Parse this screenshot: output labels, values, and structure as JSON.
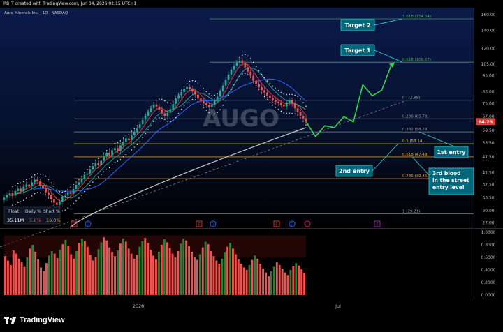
{
  "header": {
    "credit": "RB_T created with TradingView.com, Jun 04, 2026 02:15 UTC+1",
    "symbol_line": "Aura Minerals Inc. · 1D · NASDAQ"
  },
  "watermark": "AUGO",
  "brand": {
    "name": "TradingView",
    "logo_icon": "tradingview-logo-icon"
  },
  "colors": {
    "background_top": "#0a1640",
    "background_bottom": "#000000",
    "candle_up": "#26a69a",
    "candle_down": "#ef5350",
    "fib_line": "#9aa0a6",
    "fib_618": "#f5a623",
    "fib_extension": "#4caf50",
    "trendline": "#8a8a8a",
    "ma_white": "#c8c8c8",
    "ma_blue": "#2962ff",
    "ma_red": "#e53935",
    "ma_teal": "#26a69a",
    "projection": "#39d353",
    "callout_bg": "#00687a",
    "callout_border": "#39c6d6",
    "price_label_bg": "#e53935"
  },
  "stats_box": {
    "headers": [
      "Float",
      "Daily %",
      "Short %"
    ],
    "values": [
      "35.11M",
      "5.6%",
      "16.0%"
    ]
  },
  "callouts": {
    "target2": "Target 2",
    "target1": "Target 1",
    "first_entry": "1st entry",
    "second_entry": "2nd entry",
    "third_entry": "3rd blood in the street entry level"
  },
  "fib_labels": {
    "ext_1618": "1.618 (154.54)",
    "ext_0618": "0.618 (106.67)",
    "f0": "0 (77.08)",
    "f236": "0.236 (65.78)",
    "f382": "0.382 (58.79)",
    "f5": "0.5 (53.14)",
    "f618": "0.618 (47.49)",
    "f786": "0.786 (39.45)",
    "f1": "1 (29.21)"
  },
  "price_axis": {
    "ticks": [
      "160.00",
      "140.00",
      "120.00",
      "105.00",
      "95.00",
      "83.00",
      "75.00",
      "67.00",
      "59.50",
      "53.50",
      "47.50",
      "41.50",
      "37.50",
      "33.50",
      "30.00",
      "27.00"
    ],
    "current": "64.23"
  },
  "oscillator_axis": {
    "ticks": [
      "1.0000",
      "0.8000",
      "0.6000",
      "0.4000",
      "0.2000",
      "0.0000"
    ]
  },
  "time_axis": {
    "ticks": [
      "2026",
      "Jul"
    ]
  },
  "event_markers": {
    "earnings": "E",
    "dividend": "D"
  },
  "chart_data": [
    {
      "type": "candlestick",
      "title": "Aura Minerals Inc. · 1D · NASDAQ",
      "y_scale": "log",
      "ylim": [
        26,
        165
      ],
      "x": "daily sessions, Sep 2025 to early Jun 2026",
      "closes": [
        33.5,
        34.2,
        34.8,
        34.1,
        35.5,
        36.2,
        35.4,
        36.8,
        37.5,
        36.9,
        38.2,
        39.1,
        38.5,
        37.2,
        36.4,
        35.1,
        34.2,
        33.0,
        32.1,
        31.5,
        32.4,
        33.6,
        34.1,
        35.2,
        34.6,
        36.1,
        37.4,
        38.2,
        39.5,
        40.8,
        41.2,
        42.6,
        43.9,
        45.1,
        44.2,
        46.0,
        47.8,
        49.2,
        48.1,
        50.3,
        51.2,
        50.1,
        52.4,
        54.0,
        55.6,
        54.8,
        57.1,
        58.9,
        60.5,
        62.8,
        65.2,
        67.4,
        69.8,
        72.1,
        74.3,
        73.0,
        71.2,
        68.9,
        67.4,
        69.2,
        71.5,
        74.8,
        78.1,
        80.4,
        82.6,
        84.9,
        86.2,
        85.0,
        83.1,
        80.9,
        78.2,
        76.4,
        75.1,
        74.0,
        72.6,
        74.3,
        76.8,
        79.5,
        83.2,
        87.4,
        91.8,
        96.0,
        100.2,
        103.6,
        106.3,
        108.2,
        105.9,
        102.1,
        98.4,
        95.0,
        91.2,
        88.5,
        86.1,
        84.0,
        82.3,
        80.1,
        78.6,
        77.2,
        76.0,
        75.3,
        74.2,
        73.1,
        75.6,
        77.0,
        74.8,
        72.0,
        69.5,
        67.3,
        66.1,
        64.2
      ],
      "fibonacci_retracement": {
        "levels": [
          {
            "ratio": 1.618,
            "price": 154.54,
            "extension": true
          },
          {
            "ratio": 0.618,
            "price": 106.67,
            "extension": true
          },
          {
            "ratio": 0,
            "price": 77.08
          },
          {
            "ratio": 0.236,
            "price": 65.78
          },
          {
            "ratio": 0.382,
            "price": 58.79
          },
          {
            "ratio": 0.5,
            "price": 53.14
          },
          {
            "ratio": 0.618,
            "price": 47.49
          },
          {
            "ratio": 0.786,
            "price": 39.45
          },
          {
            "ratio": 1,
            "price": 29.21
          }
        ]
      },
      "projection_path": [
        64.23,
        56.5,
        62.0,
        61.0,
        67.0,
        64.0,
        88.0,
        80.0,
        84.0,
        104.0
      ],
      "last_price": 64.23
    },
    {
      "type": "bar",
      "title": "",
      "ylim": [
        0,
        1
      ],
      "values": [
        0.62,
        0.55,
        0.48,
        0.71,
        0.66,
        0.58,
        0.52,
        0.45,
        0.6,
        0.74,
        0.8,
        0.69,
        0.57,
        0.44,
        0.38,
        0.51,
        0.63,
        0.7,
        0.66,
        0.59,
        0.72,
        0.81,
        0.88,
        0.79,
        0.65,
        0.58,
        0.7,
        0.83,
        0.9,
        0.86,
        0.77,
        0.64,
        0.55,
        0.61,
        0.73,
        0.84,
        0.92,
        0.87,
        0.76,
        0.68,
        0.62,
        0.71,
        0.82,
        0.9,
        0.85,
        0.74,
        0.66,
        0.58,
        0.64,
        0.77,
        0.86,
        0.91,
        0.83,
        0.72,
        0.63,
        0.57,
        0.69,
        0.8,
        0.89,
        0.84,
        0.75,
        0.66,
        0.6,
        0.7,
        0.82,
        0.9,
        0.87,
        0.78,
        0.69,
        0.61,
        0.56,
        0.65,
        0.76,
        0.85,
        0.81,
        0.7,
        0.62,
        0.55,
        0.5,
        0.58,
        0.68,
        0.77,
        0.83,
        0.74,
        0.65,
        0.57,
        0.5,
        0.44,
        0.4,
        0.48,
        0.56,
        0.63,
        0.58,
        0.5,
        0.42,
        0.36,
        0.3,
        0.38,
        0.45,
        0.52,
        0.48,
        0.42,
        0.36,
        0.32,
        0.4,
        0.46,
        0.51,
        0.47,
        0.41,
        0.35
      ]
    }
  ]
}
